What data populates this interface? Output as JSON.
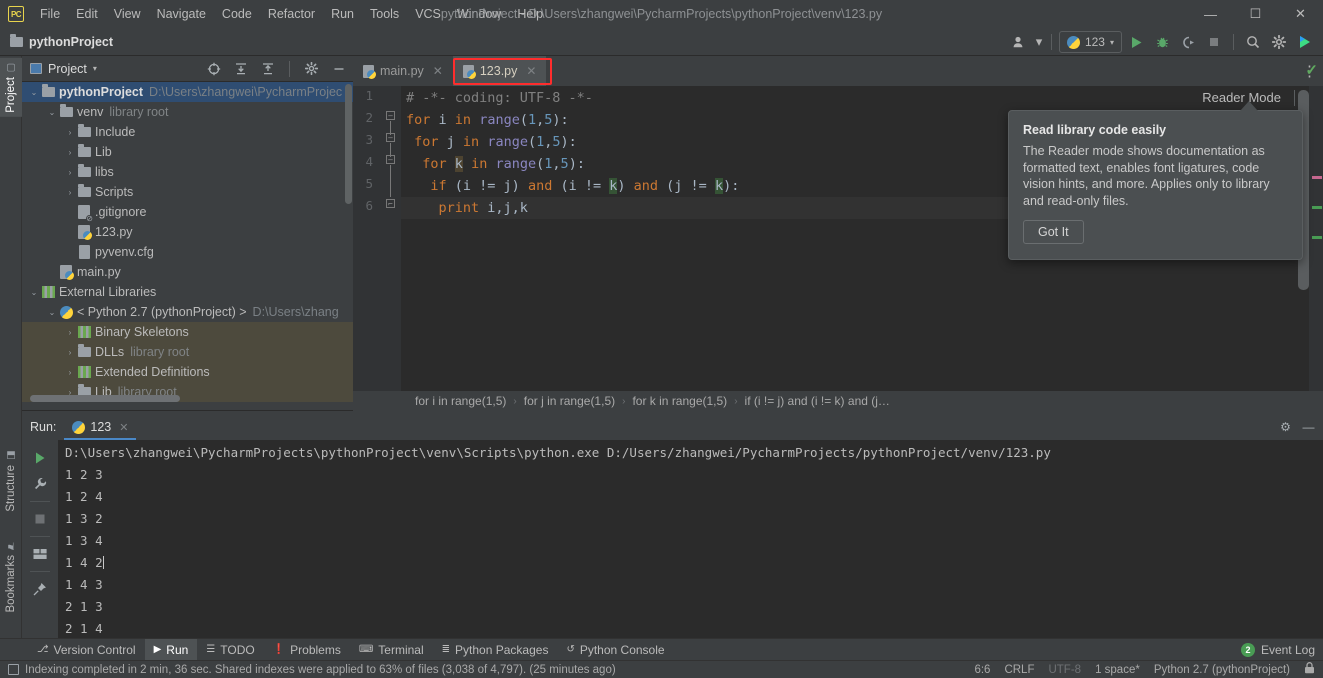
{
  "window": {
    "title": "pythonProject - D:\\Users\\zhangwei\\PycharmProjects\\pythonProject\\venv\\123.py",
    "logo": "PC",
    "minimize": "—",
    "maximize": "☐",
    "close": "✕"
  },
  "menu": [
    "File",
    "Edit",
    "View",
    "Navigate",
    "Code",
    "Refactor",
    "Run",
    "Tools",
    "VCS",
    "Window",
    "Help"
  ],
  "project_strip": {
    "name": "pythonProject",
    "folder_icon": "folder-icon"
  },
  "main_toolbar": {
    "account_icon": "user-icon",
    "account_caret": "▾",
    "run_config": "123",
    "run_config_caret": "▾",
    "run_icon": "▶",
    "debug_icon": "bug-icon",
    "coverage_icon": "run-coverage-icon",
    "stop_icon": "■",
    "search_icon": "⌕",
    "settings_icon": "⚙",
    "updates_icon": "ide-update-icon"
  },
  "left_strip": [
    {
      "label": "Project",
      "active": true
    },
    {
      "label": "Structure",
      "active": false
    },
    {
      "label": "Bookmarks",
      "active": false
    }
  ],
  "project_panel": {
    "title": "Project",
    "title_caret": "▾",
    "buttons": [
      "select-opened-file-icon",
      "expand-all-icon",
      "collapse-all-icon",
      "settings-icon",
      "hide-icon"
    ],
    "tree": [
      {
        "indent": 0,
        "arrow": "∨",
        "icon": "folder",
        "label": "pythonProject",
        "bold": true,
        "sub": "D:\\Users\\zhangwei\\PycharmProjec",
        "state": "selected"
      },
      {
        "indent": 1,
        "arrow": "∨",
        "icon": "folder",
        "label": "venv",
        "bold": false,
        "sub": "library root",
        "state": "none"
      },
      {
        "indent": 2,
        "arrow": "›",
        "icon": "folder",
        "label": "Include",
        "bold": false,
        "sub": "",
        "state": "none"
      },
      {
        "indent": 2,
        "arrow": "›",
        "icon": "folder",
        "label": "Lib",
        "bold": false,
        "sub": "",
        "state": "none"
      },
      {
        "indent": 2,
        "arrow": "›",
        "icon": "folder",
        "label": "libs",
        "bold": false,
        "sub": "",
        "state": "none"
      },
      {
        "indent": 2,
        "arrow": "›",
        "icon": "folder",
        "label": "Scripts",
        "bold": false,
        "sub": "",
        "state": "none"
      },
      {
        "indent": 2,
        "arrow": "",
        "icon": "gitignore",
        "label": ".gitignore",
        "bold": false,
        "sub": "",
        "state": "none"
      },
      {
        "indent": 2,
        "arrow": "",
        "icon": "pyfile",
        "label": "123.py",
        "bold": false,
        "sub": "",
        "state": "none"
      },
      {
        "indent": 2,
        "arrow": "",
        "icon": "cfgfile",
        "label": "pyvenv.cfg",
        "bold": false,
        "sub": "",
        "state": "none"
      },
      {
        "indent": 1,
        "arrow": "",
        "icon": "pyfile",
        "label": "main.py",
        "bold": false,
        "sub": "",
        "state": "none"
      },
      {
        "indent": 0,
        "arrow": "∨",
        "icon": "lib",
        "label": "External Libraries",
        "bold": false,
        "sub": "",
        "state": "none"
      },
      {
        "indent": 1,
        "arrow": "∨",
        "icon": "python",
        "label": "< Python 2.7 (pythonProject) >",
        "bold": false,
        "sub": "D:\\Users\\zhang",
        "state": "none"
      },
      {
        "indent": 2,
        "arrow": "›",
        "icon": "lib",
        "label": "Binary Skeletons",
        "bold": false,
        "sub": "",
        "state": "hl"
      },
      {
        "indent": 2,
        "arrow": "›",
        "icon": "folder",
        "label": "DLLs",
        "bold": false,
        "sub": "library root",
        "state": "hl"
      },
      {
        "indent": 2,
        "arrow": "›",
        "icon": "lib",
        "label": "Extended Definitions",
        "bold": false,
        "sub": "",
        "state": "hl"
      },
      {
        "indent": 2,
        "arrow": "›",
        "icon": "folder",
        "label": "Lib",
        "bold": false,
        "sub": "library root",
        "state": "hl"
      }
    ]
  },
  "editor": {
    "tabs": [
      {
        "label": "main.py",
        "active": false,
        "close": "✕",
        "highlighted": false
      },
      {
        "label": "123.py",
        "active": true,
        "close": "✕",
        "highlighted": true
      }
    ],
    "tab_overflow": "⋮",
    "reader_mode": "Reader Mode",
    "inspection_status": "✓",
    "gutter_numbers": [
      "1",
      "2",
      "3",
      "4",
      "5",
      "6"
    ],
    "code_lines": [
      {
        "n": 1,
        "tokens": [
          {
            "t": "# -*- coding: UTF-8 -*-",
            "c": "cmt"
          }
        ]
      },
      {
        "n": 2,
        "tokens": [
          {
            "t": "for",
            "c": "kw"
          },
          {
            "t": " i ",
            "c": "id"
          },
          {
            "t": "in",
            "c": "kw"
          },
          {
            "t": " ",
            "c": "id"
          },
          {
            "t": "range",
            "c": "fn"
          },
          {
            "t": "(",
            "c": "id"
          },
          {
            "t": "1",
            "c": "num"
          },
          {
            "t": ",",
            "c": "id"
          },
          {
            "t": "5",
            "c": "num"
          },
          {
            "t": "):",
            "c": "id"
          }
        ]
      },
      {
        "n": 3,
        "tokens": [
          {
            "t": " ",
            "c": "id"
          },
          {
            "t": "for",
            "c": "kw"
          },
          {
            "t": " j ",
            "c": "id"
          },
          {
            "t": "in",
            "c": "kw"
          },
          {
            "t": " ",
            "c": "id"
          },
          {
            "t": "range",
            "c": "fn"
          },
          {
            "t": "(",
            "c": "id"
          },
          {
            "t": "1",
            "c": "num"
          },
          {
            "t": ",",
            "c": "id"
          },
          {
            "t": "5",
            "c": "num"
          },
          {
            "t": "):",
            "c": "id"
          }
        ]
      },
      {
        "n": 4,
        "tokens": [
          {
            "t": "  ",
            "c": "id"
          },
          {
            "t": "for",
            "c": "kw"
          },
          {
            "t": " ",
            "c": "id"
          },
          {
            "t": "k",
            "c": "id mark2"
          },
          {
            "t": " ",
            "c": "id"
          },
          {
            "t": "in",
            "c": "kw"
          },
          {
            "t": " ",
            "c": "id"
          },
          {
            "t": "range",
            "c": "fn"
          },
          {
            "t": "(",
            "c": "id"
          },
          {
            "t": "1",
            "c": "num"
          },
          {
            "t": ",",
            "c": "id"
          },
          {
            "t": "5",
            "c": "num"
          },
          {
            "t": "):",
            "c": "id"
          }
        ]
      },
      {
        "n": 5,
        "tokens": [
          {
            "t": "   ",
            "c": "id"
          },
          {
            "t": "if",
            "c": "kw"
          },
          {
            "t": " (i != j) ",
            "c": "id"
          },
          {
            "t": "and",
            "c": "kw"
          },
          {
            "t": " (i != ",
            "c": "id"
          },
          {
            "t": "k",
            "c": "id mark"
          },
          {
            "t": ") ",
            "c": "id"
          },
          {
            "t": "and",
            "c": "kw"
          },
          {
            "t": " (j != ",
            "c": "id"
          },
          {
            "t": "k",
            "c": "id mark"
          },
          {
            "t": "):",
            "c": "id"
          }
        ]
      },
      {
        "n": 6,
        "tokens": [
          {
            "t": "    ",
            "c": "id"
          },
          {
            "t": "print",
            "c": "kw"
          },
          {
            "t": " i,j,k",
            "c": "id"
          }
        ],
        "current": true
      }
    ],
    "source_text": "# -*- coding: UTF-8 -*-\nfor i in range(1,5):\n for j in range(1,5):\n  for k in range(1,5):\n   if (i != j) and (i != k) and (j != k):\n    print i,j,k",
    "breadcrumbs": [
      "for i in range(1,5)",
      "for j in range(1,5)",
      "for k in range(1,5)",
      "if (i != j) and (i != k) and (j…"
    ],
    "breadcrumb_sep": "›"
  },
  "popup": {
    "title": "Read library code easily",
    "body": "The Reader mode shows documentation as formatted text, enables font ligatures, code vision hints, and more. Applies only to library and read-only files.",
    "button": "Got It"
  },
  "run_window": {
    "label": "Run:",
    "tab": "123",
    "tab_close": "✕",
    "settings_icon": "⚙",
    "hide_icon": "—",
    "tools": [
      "rerun-icon",
      "wrench-icon",
      "stop-icon",
      "layout-icon",
      "pin-icon"
    ],
    "console_command": "D:\\Users\\zhangwei\\PycharmProjects\\pythonProject\\venv\\Scripts\\python.exe D:/Users/zhangwei/PycharmProjects/pythonProject/venv/123.py",
    "console_output": [
      "1 2 3",
      "1 2 4",
      "1 3 2",
      "1 3 4",
      "1 4 2",
      "1 4 3",
      "2 1 3",
      "2 1 4"
    ]
  },
  "bottom_tabs": [
    {
      "label": "Version Control",
      "icon": "⎇",
      "active": false
    },
    {
      "label": "Run",
      "icon": "▶",
      "active": true
    },
    {
      "label": "TODO",
      "icon": "☰",
      "active": false
    },
    {
      "label": "Problems",
      "icon": "❗",
      "active": false
    },
    {
      "label": "Terminal",
      "icon": "⌨",
      "active": false
    },
    {
      "label": "Python Packages",
      "icon": "≣",
      "active": false
    },
    {
      "label": "Python Console",
      "icon": "↺",
      "active": false
    }
  ],
  "event_log": {
    "label": "Event Log",
    "count": "2"
  },
  "status_bar": {
    "message": "Indexing completed in 2 min, 36 sec. Shared indexes were applied to 63% of files (3,038 of 4,797). (25 minutes ago)",
    "caret_position": "6:6",
    "line_separator": "CRLF",
    "encoding": "UTF-8",
    "indent": "1 space*",
    "interpreter": "Python 2.7 (pythonProject)",
    "lock_icon": "🔒"
  },
  "colors": {
    "bg": "#3c3f41",
    "editor_bg": "#2b2b2b",
    "accent": "#4a88c7",
    "selection": "#2f4d72",
    "highlight_red": "#ff2d2d",
    "keyword": "#cc7832",
    "number": "#6897bb",
    "comment": "#808080",
    "identifier": "#a9b7c6",
    "function": "#8a86c0",
    "green": "#499c54"
  }
}
